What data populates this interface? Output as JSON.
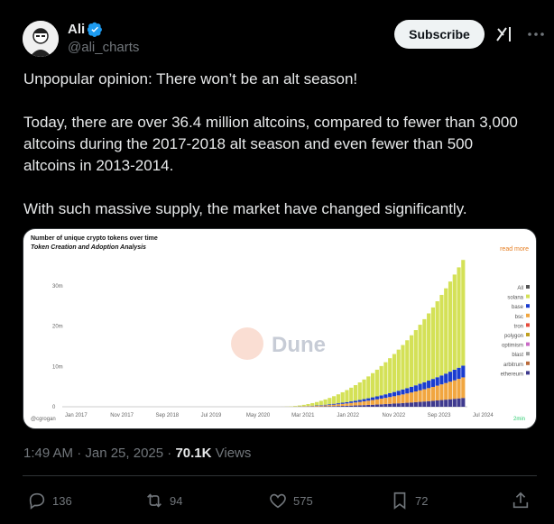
{
  "author": {
    "name": "Ali",
    "handle": "@ali_charts"
  },
  "subscribe_label": "Subscribe",
  "tweet": {
    "line1": "Unpopular opinion: There won’t be an alt season!",
    "line2": "Today, there are over 36.4 million altcoins, compared to fewer than 3,000 altcoins during the 2017-2018 alt season and even fewer than 500 altcoins in 2013-2014.",
    "line3": "With such massive supply, the market have changed significantly."
  },
  "media": {
    "title": "Number of unique crypto tokens over time",
    "subtitle": "Token Creation and Adoption Analysis",
    "read_more": "read more",
    "watermark": "Dune",
    "credit": "@cgrogan",
    "age": "2min"
  },
  "chart_data": {
    "type": "bar",
    "x_ticks": [
      "Jan 2017",
      "Nov 2017",
      "Sep 2018",
      "Jul 2019",
      "May 2020",
      "Mar 2021",
      "Jan 2022",
      "Nov 2022",
      "Sep 2023",
      "Jul 2024"
    ],
    "y_ticks": [
      "0",
      "10m",
      "20m",
      "30m"
    ],
    "ylim": [
      0,
      36000000
    ],
    "legend": [
      {
        "name": "All",
        "color": "#555555"
      },
      {
        "name": "solana",
        "color": "#d4e157"
      },
      {
        "name": "base",
        "color": "#1a3ccf"
      },
      {
        "name": "bsc",
        "color": "#f1a640"
      },
      {
        "name": "tron",
        "color": "#e74c3c"
      },
      {
        "name": "polygon",
        "color": "#c0a020"
      },
      {
        "name": "optimism",
        "color": "#c96ac6"
      },
      {
        "name": "blast",
        "color": "#9e9e9e"
      },
      {
        "name": "arbitrum",
        "color": "#b96a3a"
      },
      {
        "name": "ethereum",
        "color": "#3f3a8e"
      }
    ],
    "legend_position": "right",
    "grid": false
  },
  "meta": {
    "time": "1:49 AM · Jan 25, 2025 · ",
    "views": "70.1K",
    "views_label": " Views"
  },
  "actions": {
    "replies": "136",
    "reposts": "94",
    "likes": "575",
    "bookmarks": "72"
  }
}
